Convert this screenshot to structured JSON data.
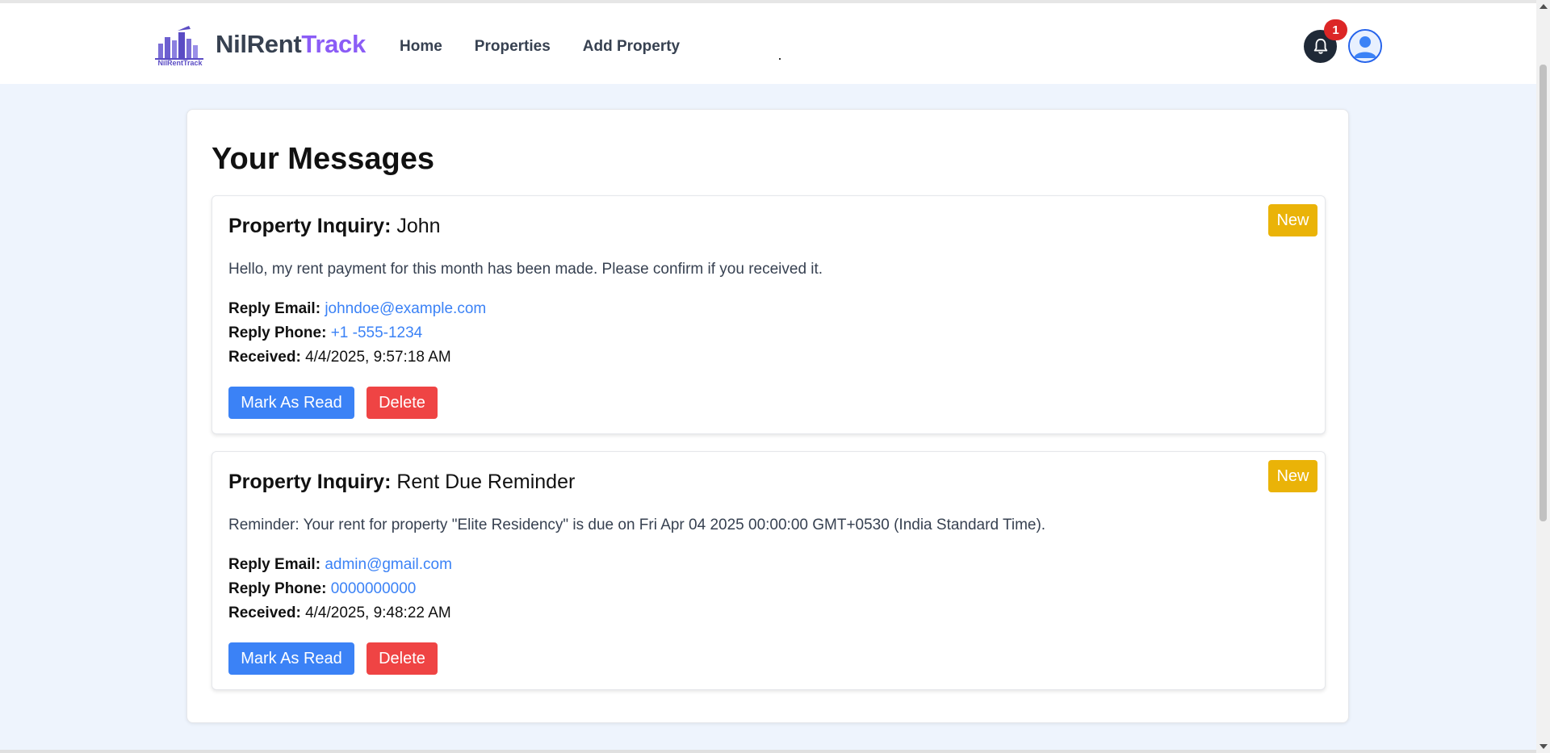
{
  "brand": {
    "name_part1": "NilRent",
    "name_part2": "Track",
    "logo_text": "NilRentTrack"
  },
  "nav": {
    "home": "Home",
    "properties": "Properties",
    "add_property": "Add Property"
  },
  "notifications": {
    "count": "1"
  },
  "page": {
    "title": "Your Messages"
  },
  "labels": {
    "subject_prefix": "Property Inquiry:",
    "reply_email": "Reply Email:",
    "reply_phone": "Reply Phone:",
    "received": "Received:",
    "new_badge": "New",
    "mark_read": "Mark As Read",
    "delete": "Delete"
  },
  "messages": [
    {
      "sender": "John",
      "body": "Hello, my rent payment for this month has been made. Please confirm if you received it.",
      "email": "johndoe@example.com",
      "phone": "+1 -555-1234",
      "received": "4/4/2025, 9:57:18 AM"
    },
    {
      "sender": "Rent Due Reminder",
      "body": "Reminder: Your rent for property \"Elite Residency\" is due on Fri Apr 04 2025 00:00:00 GMT+0530 (India Standard Time).",
      "email": "admin@gmail.com",
      "phone": "0000000000",
      "received": "4/4/2025, 9:48:22 AM"
    }
  ],
  "colors": {
    "accent": "#8b5cf6",
    "primary": "#3b82f6",
    "danger": "#ef4444",
    "badge": "#eab308",
    "background": "#eef4fd"
  },
  "icons": {
    "bell": "bell-icon",
    "avatar": "user-avatar-icon",
    "logo": "building-logo-icon"
  }
}
